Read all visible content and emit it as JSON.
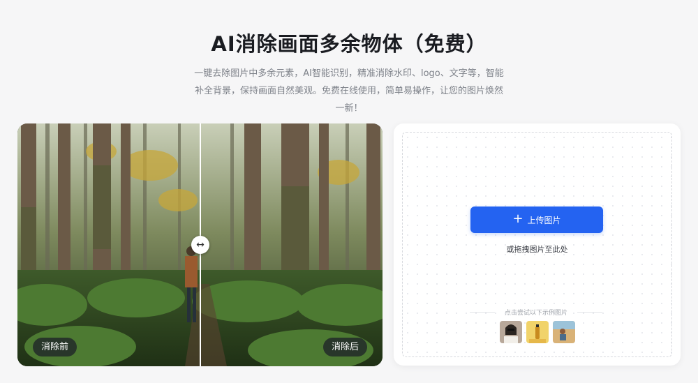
{
  "hero": {
    "title": "AI消除画面多余物体（免费）",
    "description": "一键去除图片中多余元素，AI智能识别，精准消除水印、logo、文字等，智能补全背景，保持画面自然美观。免费在线使用，简单易操作，让您的图片焕然一新！"
  },
  "compare": {
    "before_label": "消除前",
    "after_label": "消除后",
    "handle_icon": "left-right-arrow-icon"
  },
  "upload": {
    "button_label": "上传图片",
    "button_icon": "plus-icon",
    "drag_hint": "或拖拽图片至此处",
    "samples_label": "点击尝试以下示例图片",
    "accent_color": "#2463f1"
  }
}
